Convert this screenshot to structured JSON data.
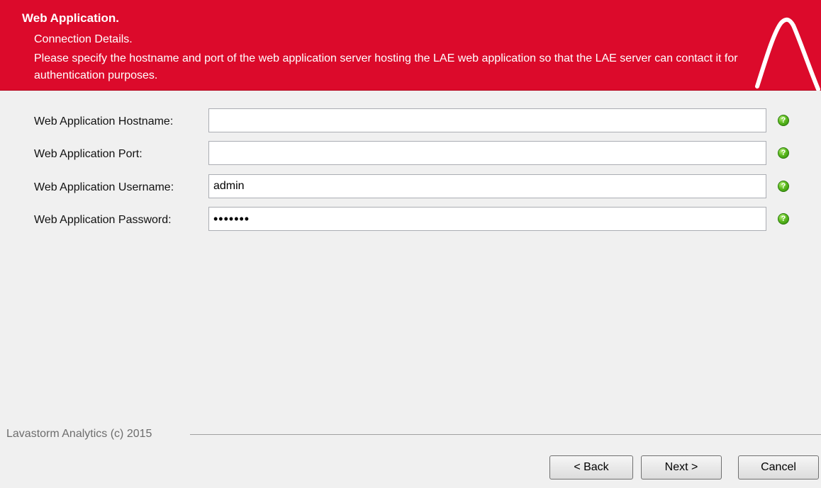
{
  "header": {
    "title": "Web Application.",
    "subtitle": "Connection Details.",
    "description": "Please specify the hostname and port of the web application server hosting the LAE web application so that the LAE server can contact it for authentication purposes."
  },
  "form": {
    "hostname": {
      "label": "Web Application Hostname:",
      "value": ""
    },
    "port": {
      "label": "Web Application Port:",
      "value": ""
    },
    "username": {
      "label": "Web Application Username:",
      "value": "admin"
    },
    "password": {
      "label": "Web Application Password:",
      "value": "•••••••"
    },
    "help_icon_text": "?"
  },
  "footer": {
    "copyright": "Lavastorm Analytics (c) 2015"
  },
  "buttons": {
    "back": "< Back",
    "next": "Next >",
    "cancel": "Cancel"
  },
  "colors": {
    "header_bg": "#dc0a2b",
    "help_icon": "#5dbb1f"
  }
}
